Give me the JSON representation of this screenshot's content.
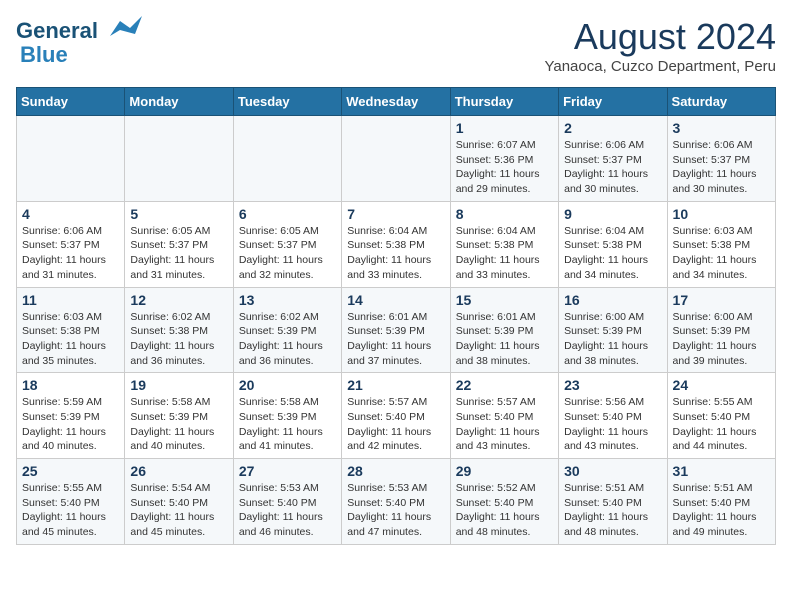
{
  "header": {
    "logo_line1": "General",
    "logo_line2": "Blue",
    "month_year": "August 2024",
    "location": "Yanaoca, Cuzco Department, Peru"
  },
  "days_of_week": [
    "Sunday",
    "Monday",
    "Tuesday",
    "Wednesday",
    "Thursday",
    "Friday",
    "Saturday"
  ],
  "weeks": [
    [
      {
        "day": "",
        "info": ""
      },
      {
        "day": "",
        "info": ""
      },
      {
        "day": "",
        "info": ""
      },
      {
        "day": "",
        "info": ""
      },
      {
        "day": "1",
        "info": "Sunrise: 6:07 AM\nSunset: 5:36 PM\nDaylight: 11 hours\nand 29 minutes."
      },
      {
        "day": "2",
        "info": "Sunrise: 6:06 AM\nSunset: 5:37 PM\nDaylight: 11 hours\nand 30 minutes."
      },
      {
        "day": "3",
        "info": "Sunrise: 6:06 AM\nSunset: 5:37 PM\nDaylight: 11 hours\nand 30 minutes."
      }
    ],
    [
      {
        "day": "4",
        "info": "Sunrise: 6:06 AM\nSunset: 5:37 PM\nDaylight: 11 hours\nand 31 minutes."
      },
      {
        "day": "5",
        "info": "Sunrise: 6:05 AM\nSunset: 5:37 PM\nDaylight: 11 hours\nand 31 minutes."
      },
      {
        "day": "6",
        "info": "Sunrise: 6:05 AM\nSunset: 5:37 PM\nDaylight: 11 hours\nand 32 minutes."
      },
      {
        "day": "7",
        "info": "Sunrise: 6:04 AM\nSunset: 5:38 PM\nDaylight: 11 hours\nand 33 minutes."
      },
      {
        "day": "8",
        "info": "Sunrise: 6:04 AM\nSunset: 5:38 PM\nDaylight: 11 hours\nand 33 minutes."
      },
      {
        "day": "9",
        "info": "Sunrise: 6:04 AM\nSunset: 5:38 PM\nDaylight: 11 hours\nand 34 minutes."
      },
      {
        "day": "10",
        "info": "Sunrise: 6:03 AM\nSunset: 5:38 PM\nDaylight: 11 hours\nand 34 minutes."
      }
    ],
    [
      {
        "day": "11",
        "info": "Sunrise: 6:03 AM\nSunset: 5:38 PM\nDaylight: 11 hours\nand 35 minutes."
      },
      {
        "day": "12",
        "info": "Sunrise: 6:02 AM\nSunset: 5:38 PM\nDaylight: 11 hours\nand 36 minutes."
      },
      {
        "day": "13",
        "info": "Sunrise: 6:02 AM\nSunset: 5:39 PM\nDaylight: 11 hours\nand 36 minutes."
      },
      {
        "day": "14",
        "info": "Sunrise: 6:01 AM\nSunset: 5:39 PM\nDaylight: 11 hours\nand 37 minutes."
      },
      {
        "day": "15",
        "info": "Sunrise: 6:01 AM\nSunset: 5:39 PM\nDaylight: 11 hours\nand 38 minutes."
      },
      {
        "day": "16",
        "info": "Sunrise: 6:00 AM\nSunset: 5:39 PM\nDaylight: 11 hours\nand 38 minutes."
      },
      {
        "day": "17",
        "info": "Sunrise: 6:00 AM\nSunset: 5:39 PM\nDaylight: 11 hours\nand 39 minutes."
      }
    ],
    [
      {
        "day": "18",
        "info": "Sunrise: 5:59 AM\nSunset: 5:39 PM\nDaylight: 11 hours\nand 40 minutes."
      },
      {
        "day": "19",
        "info": "Sunrise: 5:58 AM\nSunset: 5:39 PM\nDaylight: 11 hours\nand 40 minutes."
      },
      {
        "day": "20",
        "info": "Sunrise: 5:58 AM\nSunset: 5:39 PM\nDaylight: 11 hours\nand 41 minutes."
      },
      {
        "day": "21",
        "info": "Sunrise: 5:57 AM\nSunset: 5:40 PM\nDaylight: 11 hours\nand 42 minutes."
      },
      {
        "day": "22",
        "info": "Sunrise: 5:57 AM\nSunset: 5:40 PM\nDaylight: 11 hours\nand 43 minutes."
      },
      {
        "day": "23",
        "info": "Sunrise: 5:56 AM\nSunset: 5:40 PM\nDaylight: 11 hours\nand 43 minutes."
      },
      {
        "day": "24",
        "info": "Sunrise: 5:55 AM\nSunset: 5:40 PM\nDaylight: 11 hours\nand 44 minutes."
      }
    ],
    [
      {
        "day": "25",
        "info": "Sunrise: 5:55 AM\nSunset: 5:40 PM\nDaylight: 11 hours\nand 45 minutes."
      },
      {
        "day": "26",
        "info": "Sunrise: 5:54 AM\nSunset: 5:40 PM\nDaylight: 11 hours\nand 45 minutes."
      },
      {
        "day": "27",
        "info": "Sunrise: 5:53 AM\nSunset: 5:40 PM\nDaylight: 11 hours\nand 46 minutes."
      },
      {
        "day": "28",
        "info": "Sunrise: 5:53 AM\nSunset: 5:40 PM\nDaylight: 11 hours\nand 47 minutes."
      },
      {
        "day": "29",
        "info": "Sunrise: 5:52 AM\nSunset: 5:40 PM\nDaylight: 11 hours\nand 48 minutes."
      },
      {
        "day": "30",
        "info": "Sunrise: 5:51 AM\nSunset: 5:40 PM\nDaylight: 11 hours\nand 48 minutes."
      },
      {
        "day": "31",
        "info": "Sunrise: 5:51 AM\nSunset: 5:40 PM\nDaylight: 11 hours\nand 49 minutes."
      }
    ]
  ]
}
